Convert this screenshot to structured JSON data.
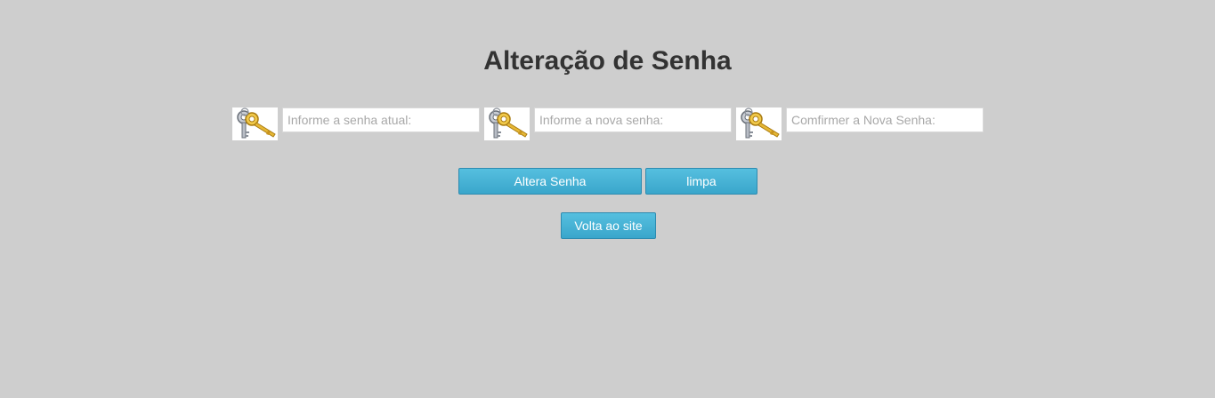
{
  "page": {
    "title": "Alteração de Senha"
  },
  "form": {
    "fields": [
      {
        "placeholder": "Informe a senha atual:",
        "value": "",
        "icon": "keys-icon"
      },
      {
        "placeholder": "Informe a nova senha:",
        "value": "",
        "icon": "keys-icon"
      },
      {
        "placeholder": "Comfirmer a Nova Senha:",
        "value": "",
        "icon": "keys-icon"
      }
    ],
    "submit_label": "Altera Senha",
    "clear_label": "limpa",
    "back_label": "Volta ao site"
  },
  "colors": {
    "background": "#cecece",
    "button": "#44afd3",
    "title": "#333333"
  }
}
